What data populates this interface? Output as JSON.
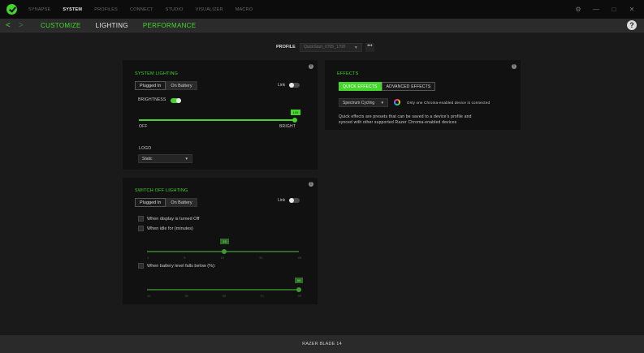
{
  "topnav": {
    "items": [
      "SYNAPSE",
      "SYSTEM",
      "PROFILES",
      "CONNECT",
      "STUDIO",
      "VISUALIZER",
      "MACRO"
    ],
    "active_index": 1
  },
  "window_controls": {
    "settings": "⚙",
    "minimize": "—",
    "maximize": "□",
    "close": "✕"
  },
  "subnav": {
    "back": "<",
    "forward": ">",
    "items": [
      "CUSTOMIZE",
      "LIGHTING",
      "PERFORMANCE"
    ],
    "active_index": 1,
    "help": "?"
  },
  "profile": {
    "label": "PROFILE",
    "value": "QuickStart_0705_1708",
    "more": "•••"
  },
  "system_lighting": {
    "title": "SYSTEM LIGHTING",
    "info": "!",
    "tabs": [
      "Plugged In",
      "On Battery"
    ],
    "active_tab": 0,
    "link_label": "Link",
    "link_on": false,
    "brightness_label": "BRIGHTNESS",
    "brightness_toggle_on": true,
    "brightness_value": "100",
    "brightness_level": 100,
    "min_label": "OFF",
    "max_label": "BRIGHT",
    "logo_label": "LOGO",
    "logo_value": "Static"
  },
  "effects": {
    "title": "EFFECTS",
    "info": "!",
    "tabs": [
      "QUICK EFFECTS",
      "ADVANCED EFFECTS"
    ],
    "active_tab": 0,
    "effect_value": "Spectrum Cycling",
    "note": "Only one Chroma-enabled device is connected",
    "description_line1": "Quick effects are presets that can be saved to a device's profile and",
    "description_line2": "synced with other supported Razer Chroma-enabled devices"
  },
  "switch_off_lighting": {
    "title": "SWITCH OFF LIGHTING",
    "info": "!",
    "tabs": [
      "Plugged In",
      "On Battery"
    ],
    "active_tab": 0,
    "link_label": "Link",
    "link_on": false,
    "display_off_label": "When display is turned Off",
    "idle_label": "When idle for (minutes)",
    "idle_value": "15",
    "idle_ticks": [
      "1",
      "5",
      "15",
      "30",
      "45"
    ],
    "battery_label": "When battery level falls below (%):",
    "battery_value": "99",
    "battery_ticks": [
      "10",
      "30",
      "50",
      "70",
      "99"
    ]
  },
  "footer": {
    "device": "RAZER BLADE 14"
  },
  "colors": {
    "accent": "#44d62c",
    "background": "#1a1a1a",
    "panel": "#111111"
  }
}
